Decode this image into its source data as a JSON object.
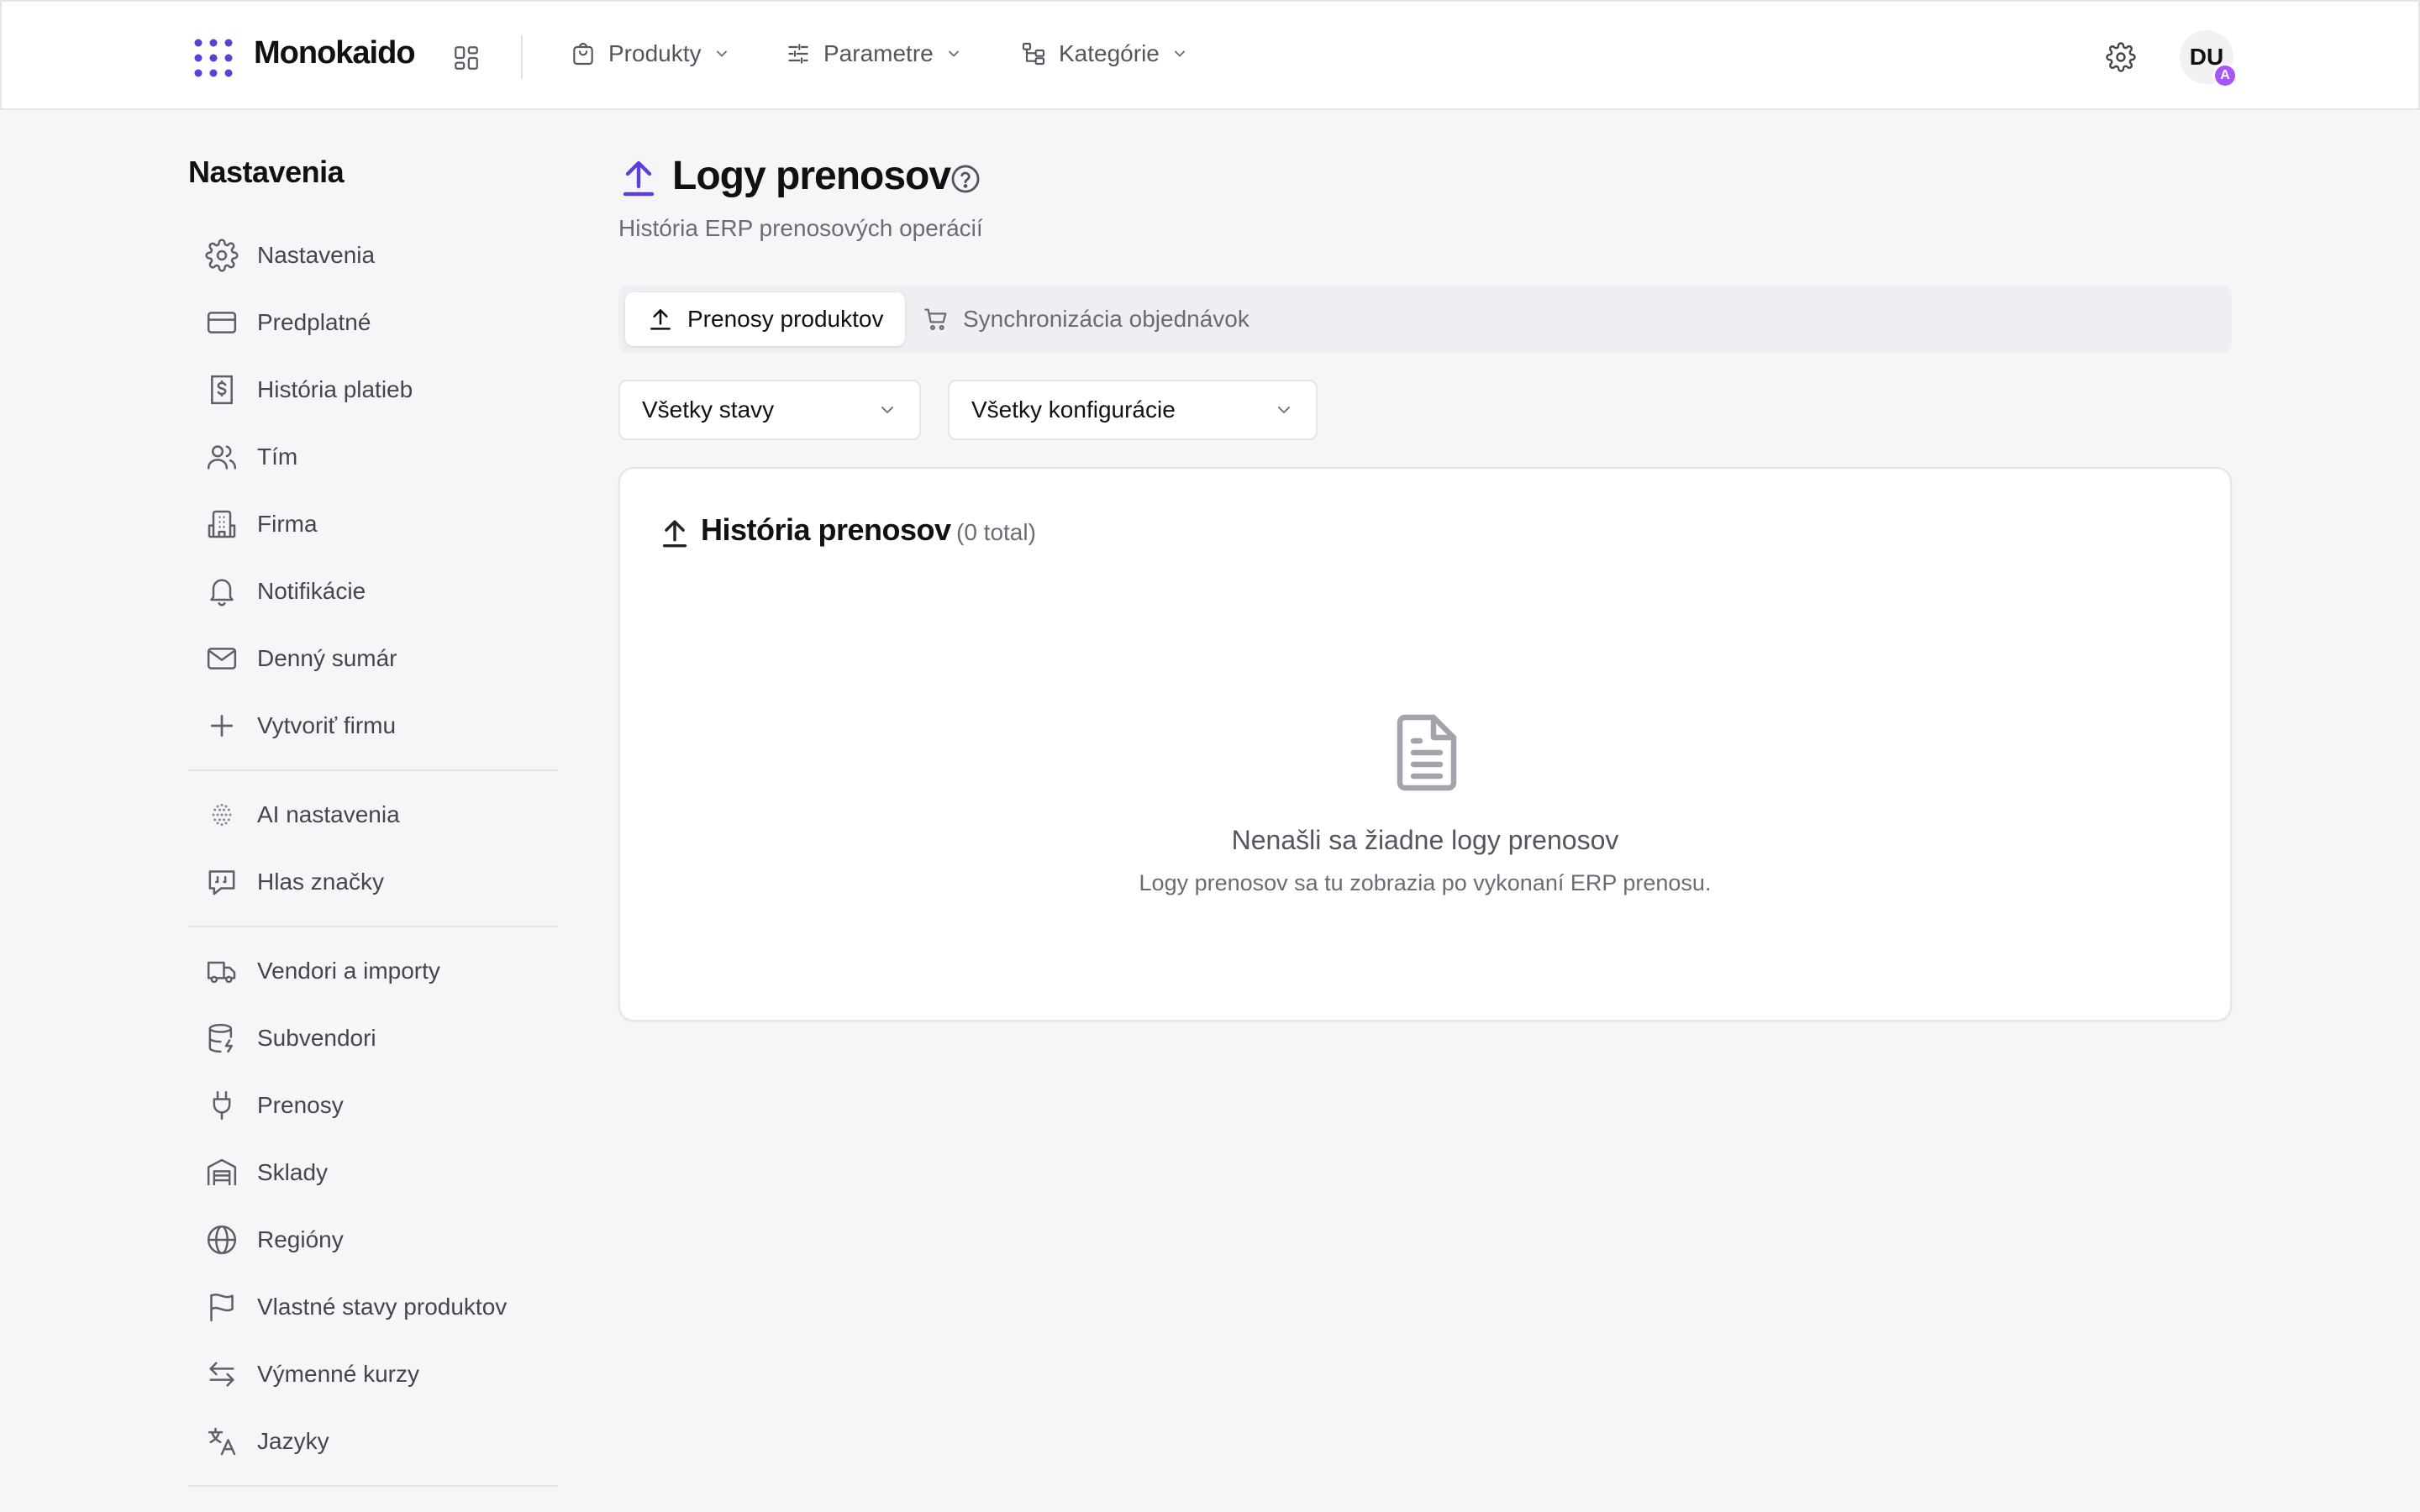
{
  "app": {
    "name": "Monokaido"
  },
  "topnav": {
    "items": [
      {
        "label": "Produkty",
        "icon": "shopping-bag-icon"
      },
      {
        "label": "Parametre",
        "icon": "sliders-icon"
      },
      {
        "label": "Kategórie",
        "icon": "category-tree-icon"
      }
    ]
  },
  "user": {
    "initials": "DU",
    "badge": "A",
    "badge_color": "#a855f7"
  },
  "sidebar": {
    "title": "Nastavenia",
    "items": [
      {
        "label": "Nastavenia",
        "icon": "gear-icon"
      },
      {
        "label": "Predplatné",
        "icon": "credit-card-icon"
      },
      {
        "label": "História platieb",
        "icon": "receipt-dollar-icon"
      },
      {
        "label": "Tím",
        "icon": "users-icon"
      },
      {
        "label": "Firma",
        "icon": "building-icon"
      },
      {
        "label": "Notifikácie",
        "icon": "bell-icon"
      },
      {
        "label": "Denný sumár",
        "icon": "mail-icon"
      },
      {
        "label": "Vytvoriť firmu",
        "icon": "plus-icon"
      },
      {
        "label": "AI nastavenia",
        "icon": "ai-sphere-icon"
      },
      {
        "label": "Hlas značky",
        "icon": "quote-message-icon"
      },
      {
        "label": "Vendori a importy",
        "icon": "truck-icon"
      },
      {
        "label": "Subvendori",
        "icon": "database-icon"
      },
      {
        "label": "Prenosy",
        "icon": "plug-icon"
      },
      {
        "label": "Sklady",
        "icon": "warehouse-icon"
      },
      {
        "label": "Regióny",
        "icon": "globe-icon"
      },
      {
        "label": "Vlastné stavy produktov",
        "icon": "flag-icon"
      },
      {
        "label": "Výmenné kurzy",
        "icon": "exchange-arrows-icon"
      },
      {
        "label": "Jazyky",
        "icon": "translate-icon"
      }
    ]
  },
  "page": {
    "title": "Logy prenosov",
    "subtitle": "História ERP prenosových operácií",
    "accent": "#5b3fd6"
  },
  "tabs": [
    {
      "label": "Prenosy produktov",
      "icon": "upload-icon",
      "active": true
    },
    {
      "label": "Synchronizácia objednávok",
      "icon": "cart-icon",
      "active": false
    }
  ],
  "filters": {
    "status": {
      "value": "Všetky stavy"
    },
    "config": {
      "value": "Všetky konfigurácie"
    }
  },
  "card": {
    "title": "História prenosov",
    "count": "(0 total)",
    "empty": {
      "title": "Nenašli sa žiadne logy prenosov",
      "subtitle": "Logy prenosov sa tu zobrazia po vykonaní ERP prenosu."
    }
  }
}
